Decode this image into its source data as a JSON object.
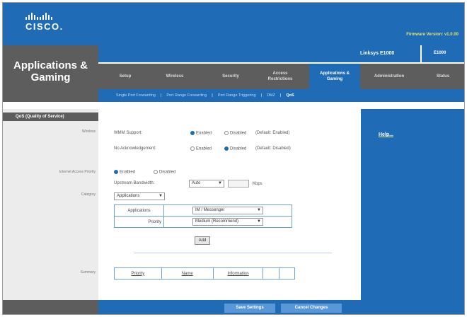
{
  "brand": {
    "logo_text": "CISCO."
  },
  "firmware_text": "Firmware Version: v1.0.00",
  "section_title": "Applications &\nGaming",
  "model": {
    "name": "Linksys E1000",
    "code": "E1000"
  },
  "tabs": [
    "Setup",
    "Wireless",
    "Security",
    "Access\nRestrictions",
    "Applications &\nGaming",
    "Administration",
    "Status"
  ],
  "subtabs": [
    "Single Port Forwarding",
    "Port Range Forwarding",
    "Port Range Triggering",
    "DMZ",
    "QoS"
  ],
  "left": {
    "qos_header": "QoS (Quality of Service)",
    "wireless": "Wireless",
    "internet_access_priority": "Internet Access Priority",
    "category": "Category",
    "summary": "Summary"
  },
  "help_link": "Help...",
  "wireless": {
    "wmm_label": "WMM Support:",
    "wmm_enabled": "Enabled",
    "wmm_disabled": "Disabled",
    "wmm_default": "(Default: Enabled)",
    "noack_label": "No Acknowledgement:",
    "noack_enabled": "Enabled",
    "noack_disabled": "Disabled",
    "noack_default": "(Default: Disabled)"
  },
  "iap": {
    "enabled": "Enabled",
    "disabled": "Disabled",
    "upstream_label": "Upstream Bandwidth:",
    "upstream_value": "Auto",
    "upstream_unit": "Kbps"
  },
  "category": {
    "selected": "Applications",
    "applications_label": "Applications",
    "applications_value": "IM / Messenger",
    "priority_label": "Priority",
    "priority_value": "Medium (Recommend)",
    "add_button": "Add"
  },
  "summary": {
    "columns": [
      "Priority",
      "Name",
      "Information"
    ]
  },
  "footer": {
    "save": "Save Settings",
    "cancel": "Cancel Changes"
  },
  "colors": {
    "brand_blue": "#1f6bb5",
    "dark_gray": "#5d5d5d",
    "firmware_yellow": "#e4e46b"
  }
}
